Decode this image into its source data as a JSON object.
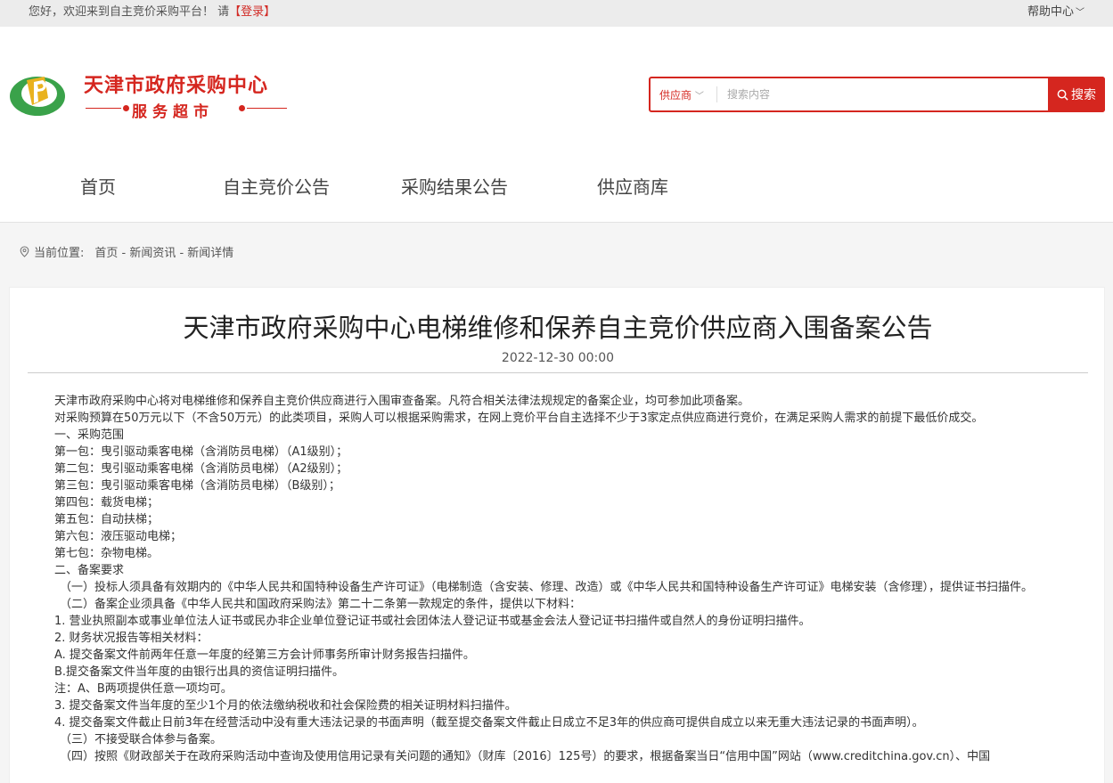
{
  "topbar": {
    "welcome": "您好，欢迎来到自主竞价采购平台！ 请",
    "login": "【登录】",
    "help": "帮助中心"
  },
  "logo": {
    "title": "天津市政府采购中心",
    "subtitle": "服务超市"
  },
  "search": {
    "type": "供应商",
    "placeholder": "搜索内容",
    "button": "搜索"
  },
  "nav": [
    "首页",
    "自主竞价公告",
    "采购结果公告",
    "供应商库"
  ],
  "breadcrumb": {
    "label": "当前位置:",
    "path": "首页 - 新闻资讯 - 新闻详情"
  },
  "article": {
    "title": "天津市政府采购中心电梯维修和保养自主竞价供应商入围备案公告",
    "date": "2022-12-30 00:00",
    "paragraphs": [
      "天津市政府采购中心将对电梯维修和保养自主竞价供应商进行入围审查备案。凡符合相关法律法规规定的备案企业，均可参加此项备案。",
      "对采购预算在50万元以下（不含50万元）的此类项目，采购人可以根据采购需求，在网上竞价平台自主选择不少于3家定点供应商进行竞价，在满足采购人需求的前提下最低价成交。",
      "一、采购范围",
      "第一包：曳引驱动乘客电梯（含消防员电梯）（A1级别）；",
      "第二包：曳引驱动乘客电梯（含消防员电梯）（A2级别）；",
      "第三包：曳引驱动乘客电梯（含消防员电梯）（B级别）；",
      "第四包：载货电梯；",
      "第五包：自动扶梯；",
      "第六包：液压驱动电梯；",
      "第七包：杂物电梯。",
      "二、备案要求",
      "（一）投标人须具备有效期内的《中华人民共和国特种设备生产许可证》（电梯制造（含安装、修理、改造）或《中华人民共和国特种设备生产许可证》电梯安装（含修理），提供证书扫描件。",
      "（二）备案企业须具备《中华人民共和国政府采购法》第二十二条第一款规定的条件，提供以下材料：",
      "1. 营业执照副本或事业单位法人证书或民办非企业单位登记证书或社会团体法人登记证书或基金会法人登记证书扫描件或自然人的身份证明扫描件。",
      "2. 财务状况报告等相关材料：",
      "A. 提交备案文件前两年任意一年度的经第三方会计师事务所审计财务报告扫描件。",
      "B.提交备案文件当年度的由银行出具的资信证明扫描件。",
      "注：A、B两项提供任意一项均可。",
      "3. 提交备案文件当年度的至少1个月的依法缴纳税收和社会保险费的相关证明材料扫描件。",
      "4. 提交备案文件截止日前3年在经营活动中没有重大违法记录的书面声明（截至提交备案文件截止日成立不足3年的供应商可提供自成立以来无重大违法记录的书面声明）。",
      "（三）不接受联合体参与备案。",
      "（四）按照《财政部关于在政府采购活动中查询及使用信用记录有关问题的通知》（财库〔2016〕125号）的要求，根据备案当日“信用中国”网站（www.creditchina.gov.cn）、中国"
    ]
  }
}
